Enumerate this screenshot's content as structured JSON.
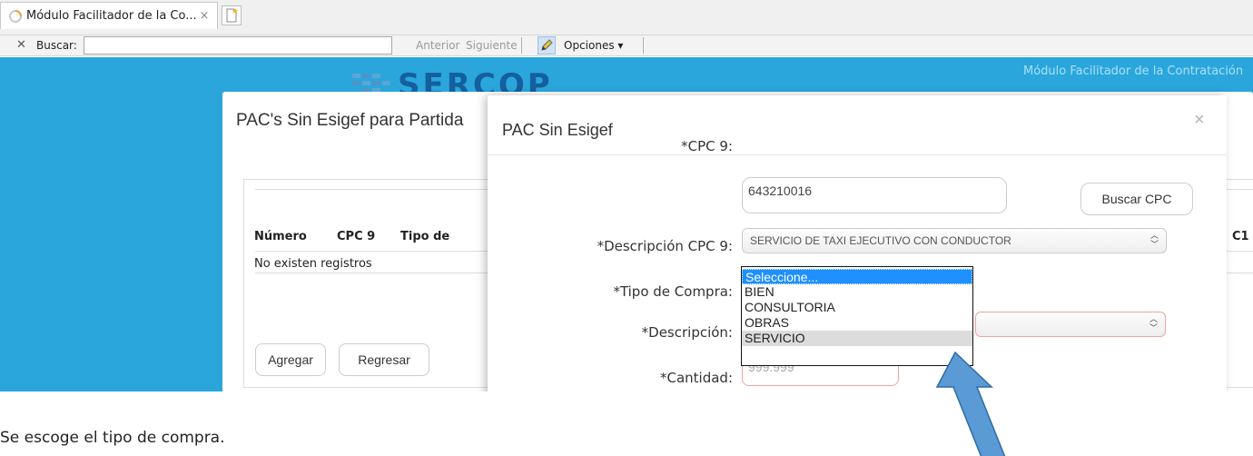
{
  "browser": {
    "tab_title": "Módulo Facilitador de la Co...",
    "tab_close": "×",
    "find_close": "✕",
    "find_label": "Buscar:",
    "find_value": "",
    "find_prev": "Anterior",
    "find_next": "Siguiente",
    "find_options": "Opciones ▾"
  },
  "header": {
    "logo": "SERCOP",
    "module_title": "Módulo Facilitador de la Contratación"
  },
  "back_modal": {
    "title": "PAC's Sin Esigef para Partida",
    "columns": [
      "Número",
      "CPC 9",
      "Tipo de",
      "C1"
    ],
    "empty_message": "No existen registros",
    "buttons": {
      "add": "Agregar",
      "back": "Regresar"
    }
  },
  "front_modal": {
    "title": "PAC Sin Esigef",
    "close": "×",
    "fields": {
      "cpc_label": "*CPC 9:",
      "cpc_value": "643210016",
      "search_cpc": "Buscar CPC",
      "desc_cpc_label": "*Descripción CPC 9:",
      "desc_cpc_value": "SERVICIO DE TAXI EJECUTIVO CON CONDUCTOR",
      "tipo_label": "*Tipo de Compra:",
      "desc_label": "*Descripción:",
      "cant_label": "*Cantidad:",
      "cant_placeholder": "999.999"
    },
    "tipo_options": [
      "Seleccione...",
      "BIEN",
      "CONSULTORIA",
      "OBRAS",
      "SERVICIO"
    ],
    "selected_option": "Seleccione...",
    "hovered_option": "SERVICIO"
  },
  "caption": "Se escoge el tipo de compra.",
  "colors": {
    "page_bg": "#2aa6dc",
    "logo": "#145f9e",
    "selected": "#1e90ff",
    "arrow": "#5b9bd5"
  }
}
